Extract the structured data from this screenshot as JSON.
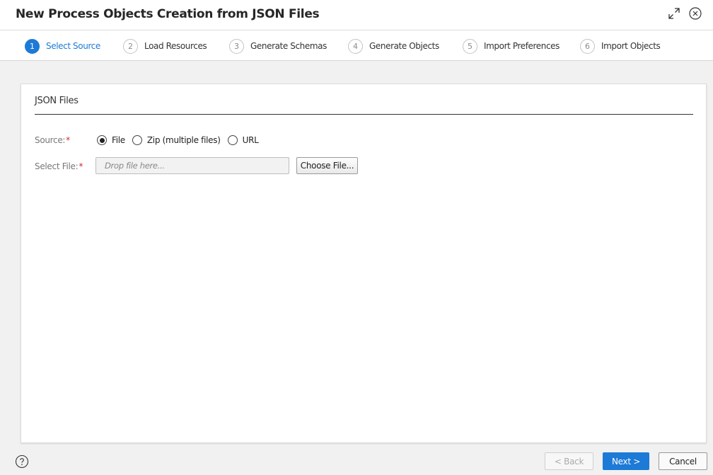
{
  "dialog": {
    "title": "New Process Objects Creation from JSON Files",
    "expand_icon": "expand-arrows-icon",
    "close_icon": "close-circle-icon"
  },
  "steps": [
    {
      "number": "1",
      "label": "Select Source",
      "active": true
    },
    {
      "number": "2",
      "label": "Load Resources",
      "active": false
    },
    {
      "number": "3",
      "label": "Generate Schemas",
      "active": false
    },
    {
      "number": "4",
      "label": "Generate Objects",
      "active": false
    },
    {
      "number": "5",
      "label": "Import Preferences",
      "active": false
    },
    {
      "number": "6",
      "label": "Import Objects",
      "active": false
    }
  ],
  "section": {
    "title": "JSON Files"
  },
  "form": {
    "source_label": "Source:",
    "required_mark": "*",
    "source_options": [
      {
        "label": "File",
        "checked": true
      },
      {
        "label": "Zip (multiple files)",
        "checked": false
      },
      {
        "label": "URL",
        "checked": false
      }
    ],
    "select_file_label": "Select File:",
    "file_placeholder": "Drop file here...",
    "file_value": "",
    "choose_file_label": "Choose File..."
  },
  "footer": {
    "help_icon": "help-circle-icon",
    "back_label": "< Back",
    "next_label": "Next >",
    "cancel_label": "Cancel"
  },
  "colors": {
    "accent": "#1d7ad6",
    "required": "#d22b2b",
    "background": "#f1f1f1"
  }
}
